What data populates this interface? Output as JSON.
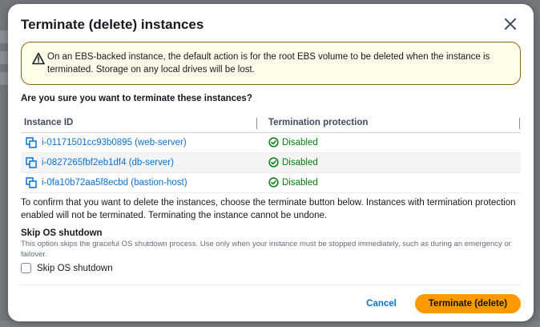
{
  "modal": {
    "title": "Terminate (delete) instances"
  },
  "alert": {
    "text": "On an EBS-backed instance, the default action is for the root EBS volume to be deleted when the instance is terminated. Storage on any local drives will be lost.",
    "icon": "warning-icon",
    "color": "#8c6614"
  },
  "question": "Are you sure you want to terminate these instances?",
  "table": {
    "headers": [
      "Instance ID",
      "Termination protection"
    ],
    "rows": [
      {
        "id": "i-01171501cc93b0895 (web-server)",
        "status": "Disabled"
      },
      {
        "id": "i-0827265fbf2eb1df4 (db-server)",
        "status": "Disabled"
      },
      {
        "id": "i-0fa10b72aa5f8ecbd (bastion-host)",
        "status": "Disabled"
      }
    ]
  },
  "confirm_text": "To confirm that you want to delete the instances, choose the terminate button below. Instances with termination protection enabled will not be terminated. Terminating the instance cannot be undone.",
  "skip_shutdown": {
    "title": "Skip OS shutdown",
    "description": "This option skips the graceful OS shutdown process. Use only when your instance must be stopped immediately, such as during an emergency or failover.",
    "checkbox_label": "Skip OS shutdown",
    "checked": false
  },
  "footer": {
    "cancel_label": "Cancel",
    "terminate_label": "Terminate (delete)"
  },
  "colors": {
    "link": "#0972d3",
    "success": "#037f0c",
    "primary_button": "#ff9900"
  }
}
